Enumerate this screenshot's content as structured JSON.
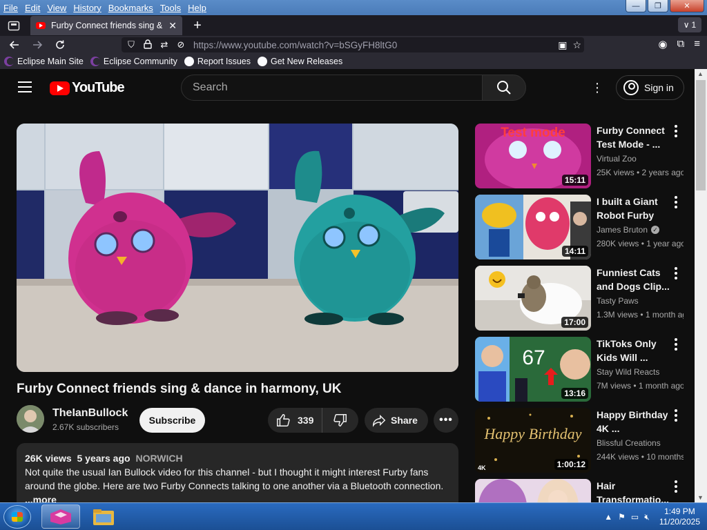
{
  "menubar": {
    "items": [
      "File",
      "Edit",
      "View",
      "History",
      "Bookmarks",
      "Tools",
      "Help"
    ]
  },
  "window_controls": {
    "minimize": "—",
    "maximize": "❐",
    "close": "✕"
  },
  "tab": {
    "title": "Furby Connect friends sing & dance in harmony, UK",
    "overflow_count": "1"
  },
  "navbar": {
    "url_host": "https://www.youtube.com",
    "url_path": "/watch?v=bSGyFH8ltG0"
  },
  "bookmarks": [
    "Eclipse Main Site",
    "Eclipse Community",
    "Report Issues",
    "Get New Releases"
  ],
  "youtube": {
    "logo_text": "YouTube",
    "search_placeholder": "Search",
    "sign_in": "Sign in"
  },
  "video": {
    "title": "Furby Connect friends sing & dance in harmony, UK",
    "channel": "TheIanBullock",
    "subscribers": "2.67K subscribers",
    "subscribe_label": "Subscribe",
    "likes": "339",
    "share_label": "Share",
    "views": "26K views",
    "age": "5 years ago",
    "location_tag": "NORWICH",
    "description": "Not quite the usual Ian Bullock video for this channel - but I thought it might interest Furby fans around the globe. Here are two Furby Connects talking to one another via a Bluetooth connection.",
    "more": "...more"
  },
  "recommendations": [
    {
      "title": "Furby Connect Test Mode - ...",
      "channel": "Virtual Zoo",
      "meta": "25K views • 2 years ago",
      "duration": "15:11",
      "verified": false,
      "thumb_text": "Test mode"
    },
    {
      "title": "I built a Giant Robot Furby",
      "channel": "James Bruton",
      "meta": "280K views • 1 year ago",
      "duration": "14:11",
      "verified": true
    },
    {
      "title": "Funniest Cats and Dogs Clip...",
      "channel": "Tasty Paws",
      "meta": "1.3M views • 1 month ago",
      "duration": "17:00",
      "verified": false
    },
    {
      "title": "TikToks Only Kids Will ...",
      "channel": "Stay Wild Reacts",
      "meta": "7M views • 1 month ago",
      "duration": "13:16",
      "verified": false,
      "thumb_text": "67"
    },
    {
      "title": "Happy Birthday 4K ...",
      "channel": "Blissful Creations",
      "meta": "244K views • 10 months ago",
      "duration": "1:00:12",
      "verified": false,
      "thumb_text": "Happy Birthday",
      "badge": "4K"
    },
    {
      "title": "Hair Transformatio...",
      "channel": "",
      "meta": "",
      "duration": "",
      "verified": false
    }
  ],
  "taskbar": {
    "time": "1:49 PM",
    "date": "11/20/2025"
  },
  "colors": {
    "yt_red": "#ff0000",
    "page_bg": "#0f0f0f",
    "chrome_bg": "#2b2a33"
  }
}
